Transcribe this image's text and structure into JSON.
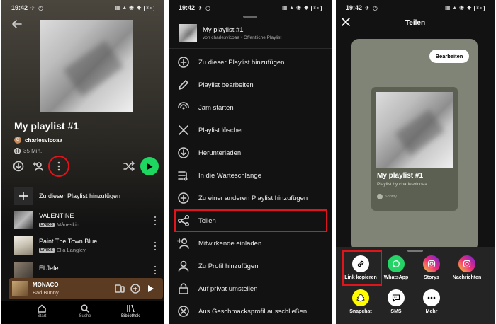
{
  "status": {
    "time": "19:42"
  },
  "screen1": {
    "playlist_title": "My playlist #1",
    "owner": "charlesvicoaa",
    "owner_initial": "C",
    "duration": "35 Min.",
    "add_label": "Zu dieser Playlist hinzufügen",
    "songs": [
      {
        "title": "VALENTINE",
        "artist": "Måneskin",
        "lyrics": "LYRICS"
      },
      {
        "title": "Paint The Town Blue",
        "artist": "Ella Langley",
        "lyrics": "LYRICS"
      },
      {
        "title": "El Jefe",
        "artist": "",
        "lyrics": ""
      }
    ],
    "now_playing": {
      "title": "MONACO",
      "artist": "Bad Bunny"
    },
    "nav": {
      "home": "Start",
      "search": "Suche",
      "library": "Bibliothek"
    }
  },
  "screen2": {
    "header_title": "My playlist #1",
    "header_sub": "von charlesvicoaa • Öffentliche Playlist",
    "menu": [
      {
        "label": "Zu dieser Playlist hinzufügen",
        "icon": "plus-circle-icon"
      },
      {
        "label": "Playlist bearbeiten",
        "icon": "pencil-icon"
      },
      {
        "label": "Jam starten",
        "icon": "jam-icon"
      },
      {
        "label": "Playlist löschen",
        "icon": "x-icon"
      },
      {
        "label": "Herunterladen",
        "icon": "download-icon"
      },
      {
        "label": "In die Warteschlange",
        "icon": "queue-icon"
      },
      {
        "label": "Zu einer anderen Playlist hinzufügen",
        "icon": "plus-circle-icon"
      },
      {
        "label": "Teilen",
        "icon": "share-icon"
      },
      {
        "label": "Mitwirkende einladen",
        "icon": "add-user-icon"
      },
      {
        "label": "Zu Profil hinzufügen",
        "icon": "profile-icon"
      },
      {
        "label": "Auf privat umstellen",
        "icon": "lock-icon"
      },
      {
        "label": "Aus Geschmacksprofil ausschließen",
        "icon": "exclude-icon"
      }
    ]
  },
  "screen3": {
    "title": "Teilen",
    "edit_label": "Bearbeiten",
    "card_title": "My playlist #1",
    "card_sub": "Playlist by charlesvicoaa",
    "card_brand": "Spotify",
    "share_row1": [
      {
        "label": "Link kopieren",
        "icon": "link-icon",
        "color": "#ffffff"
      },
      {
        "label": "WhatsApp",
        "icon": "whatsapp-icon",
        "color": "#25d366"
      },
      {
        "label": "Storys",
        "icon": "instagram-icon",
        "color": "#d62976"
      },
      {
        "label": "Nachrichten",
        "icon": "instagram-icon",
        "color": "#d62976"
      }
    ],
    "share_row2": [
      {
        "label": "Snapchat",
        "icon": "snapchat-icon",
        "color": "#fffc00"
      },
      {
        "label": "SMS",
        "icon": "sms-icon",
        "color": "#ffffff"
      },
      {
        "label": "Mehr",
        "icon": "more-icon",
        "color": "#ffffff"
      }
    ]
  },
  "colors": {
    "spotify_green": "#1ed760",
    "highlight_red": "#e0141b",
    "background": "#121212"
  }
}
